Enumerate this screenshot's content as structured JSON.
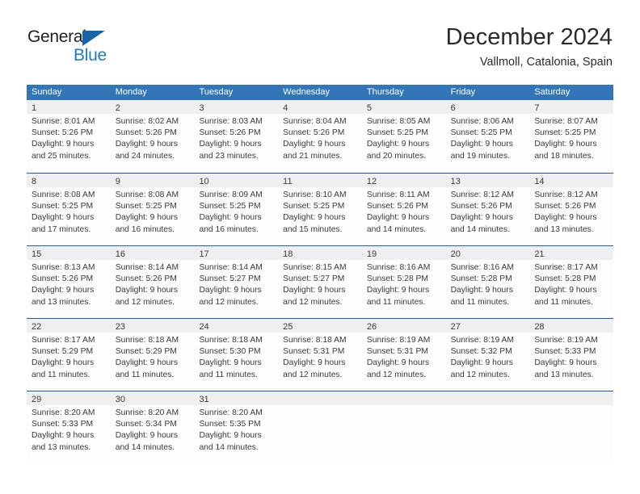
{
  "brand": {
    "name_top": "General",
    "name_bottom": "Blue",
    "triangle_color": "#1565a8",
    "blue_color": "#1f7cc4"
  },
  "header": {
    "title": "December 2024",
    "subtitle": "Vallmoll, Catalonia, Spain"
  },
  "theme": {
    "header_blue": "#3275b8",
    "row_border_blue": "#1f5f9e",
    "daynum_band": "#efefef",
    "text": "#3a3a3a"
  },
  "weekdays": [
    "Sunday",
    "Monday",
    "Tuesday",
    "Wednesday",
    "Thursday",
    "Friday",
    "Saturday"
  ],
  "weeks": [
    {
      "days": [
        {
          "num": "1",
          "l1": "Sunrise: 8:01 AM",
          "l2": "Sunset: 5:26 PM",
          "l3": "Daylight: 9 hours",
          "l4": "and 25 minutes."
        },
        {
          "num": "2",
          "l1": "Sunrise: 8:02 AM",
          "l2": "Sunset: 5:26 PM",
          "l3": "Daylight: 9 hours",
          "l4": "and 24 minutes."
        },
        {
          "num": "3",
          "l1": "Sunrise: 8:03 AM",
          "l2": "Sunset: 5:26 PM",
          "l3": "Daylight: 9 hours",
          "l4": "and 23 minutes."
        },
        {
          "num": "4",
          "l1": "Sunrise: 8:04 AM",
          "l2": "Sunset: 5:26 PM",
          "l3": "Daylight: 9 hours",
          "l4": "and 21 minutes."
        },
        {
          "num": "5",
          "l1": "Sunrise: 8:05 AM",
          "l2": "Sunset: 5:25 PM",
          "l3": "Daylight: 9 hours",
          "l4": "and 20 minutes."
        },
        {
          "num": "6",
          "l1": "Sunrise: 8:06 AM",
          "l2": "Sunset: 5:25 PM",
          "l3": "Daylight: 9 hours",
          "l4": "and 19 minutes."
        },
        {
          "num": "7",
          "l1": "Sunrise: 8:07 AM",
          "l2": "Sunset: 5:25 PM",
          "l3": "Daylight: 9 hours",
          "l4": "and 18 minutes."
        }
      ]
    },
    {
      "days": [
        {
          "num": "8",
          "l1": "Sunrise: 8:08 AM",
          "l2": "Sunset: 5:25 PM",
          "l3": "Daylight: 9 hours",
          "l4": "and 17 minutes."
        },
        {
          "num": "9",
          "l1": "Sunrise: 8:08 AM",
          "l2": "Sunset: 5:25 PM",
          "l3": "Daylight: 9 hours",
          "l4": "and 16 minutes."
        },
        {
          "num": "10",
          "l1": "Sunrise: 8:09 AM",
          "l2": "Sunset: 5:25 PM",
          "l3": "Daylight: 9 hours",
          "l4": "and 16 minutes."
        },
        {
          "num": "11",
          "l1": "Sunrise: 8:10 AM",
          "l2": "Sunset: 5:25 PM",
          "l3": "Daylight: 9 hours",
          "l4": "and 15 minutes."
        },
        {
          "num": "12",
          "l1": "Sunrise: 8:11 AM",
          "l2": "Sunset: 5:26 PM",
          "l3": "Daylight: 9 hours",
          "l4": "and 14 minutes."
        },
        {
          "num": "13",
          "l1": "Sunrise: 8:12 AM",
          "l2": "Sunset: 5:26 PM",
          "l3": "Daylight: 9 hours",
          "l4": "and 14 minutes."
        },
        {
          "num": "14",
          "l1": "Sunrise: 8:12 AM",
          "l2": "Sunset: 5:26 PM",
          "l3": "Daylight: 9 hours",
          "l4": "and 13 minutes."
        }
      ]
    },
    {
      "days": [
        {
          "num": "15",
          "l1": "Sunrise: 8:13 AM",
          "l2": "Sunset: 5:26 PM",
          "l3": "Daylight: 9 hours",
          "l4": "and 13 minutes."
        },
        {
          "num": "16",
          "l1": "Sunrise: 8:14 AM",
          "l2": "Sunset: 5:26 PM",
          "l3": "Daylight: 9 hours",
          "l4": "and 12 minutes."
        },
        {
          "num": "17",
          "l1": "Sunrise: 8:14 AM",
          "l2": "Sunset: 5:27 PM",
          "l3": "Daylight: 9 hours",
          "l4": "and 12 minutes."
        },
        {
          "num": "18",
          "l1": "Sunrise: 8:15 AM",
          "l2": "Sunset: 5:27 PM",
          "l3": "Daylight: 9 hours",
          "l4": "and 12 minutes."
        },
        {
          "num": "19",
          "l1": "Sunrise: 8:16 AM",
          "l2": "Sunset: 5:28 PM",
          "l3": "Daylight: 9 hours",
          "l4": "and 11 minutes."
        },
        {
          "num": "20",
          "l1": "Sunrise: 8:16 AM",
          "l2": "Sunset: 5:28 PM",
          "l3": "Daylight: 9 hours",
          "l4": "and 11 minutes."
        },
        {
          "num": "21",
          "l1": "Sunrise: 8:17 AM",
          "l2": "Sunset: 5:28 PM",
          "l3": "Daylight: 9 hours",
          "l4": "and 11 minutes."
        }
      ]
    },
    {
      "days": [
        {
          "num": "22",
          "l1": "Sunrise: 8:17 AM",
          "l2": "Sunset: 5:29 PM",
          "l3": "Daylight: 9 hours",
          "l4": "and 11 minutes."
        },
        {
          "num": "23",
          "l1": "Sunrise: 8:18 AM",
          "l2": "Sunset: 5:29 PM",
          "l3": "Daylight: 9 hours",
          "l4": "and 11 minutes."
        },
        {
          "num": "24",
          "l1": "Sunrise: 8:18 AM",
          "l2": "Sunset: 5:30 PM",
          "l3": "Daylight: 9 hours",
          "l4": "and 11 minutes."
        },
        {
          "num": "25",
          "l1": "Sunrise: 8:18 AM",
          "l2": "Sunset: 5:31 PM",
          "l3": "Daylight: 9 hours",
          "l4": "and 12 minutes."
        },
        {
          "num": "26",
          "l1": "Sunrise: 8:19 AM",
          "l2": "Sunset: 5:31 PM",
          "l3": "Daylight: 9 hours",
          "l4": "and 12 minutes."
        },
        {
          "num": "27",
          "l1": "Sunrise: 8:19 AM",
          "l2": "Sunset: 5:32 PM",
          "l3": "Daylight: 9 hours",
          "l4": "and 12 minutes."
        },
        {
          "num": "28",
          "l1": "Sunrise: 8:19 AM",
          "l2": "Sunset: 5:33 PM",
          "l3": "Daylight: 9 hours",
          "l4": "and 13 minutes."
        }
      ]
    },
    {
      "days": [
        {
          "num": "29",
          "l1": "Sunrise: 8:20 AM",
          "l2": "Sunset: 5:33 PM",
          "l3": "Daylight: 9 hours",
          "l4": "and 13 minutes."
        },
        {
          "num": "30",
          "l1": "Sunrise: 8:20 AM",
          "l2": "Sunset: 5:34 PM",
          "l3": "Daylight: 9 hours",
          "l4": "and 14 minutes."
        },
        {
          "num": "31",
          "l1": "Sunrise: 8:20 AM",
          "l2": "Sunset: 5:35 PM",
          "l3": "Daylight: 9 hours",
          "l4": "and 14 minutes."
        },
        {
          "num": "",
          "l1": "",
          "l2": "",
          "l3": "",
          "l4": ""
        },
        {
          "num": "",
          "l1": "",
          "l2": "",
          "l3": "",
          "l4": ""
        },
        {
          "num": "",
          "l1": "",
          "l2": "",
          "l3": "",
          "l4": ""
        },
        {
          "num": "",
          "l1": "",
          "l2": "",
          "l3": "",
          "l4": ""
        }
      ]
    }
  ]
}
